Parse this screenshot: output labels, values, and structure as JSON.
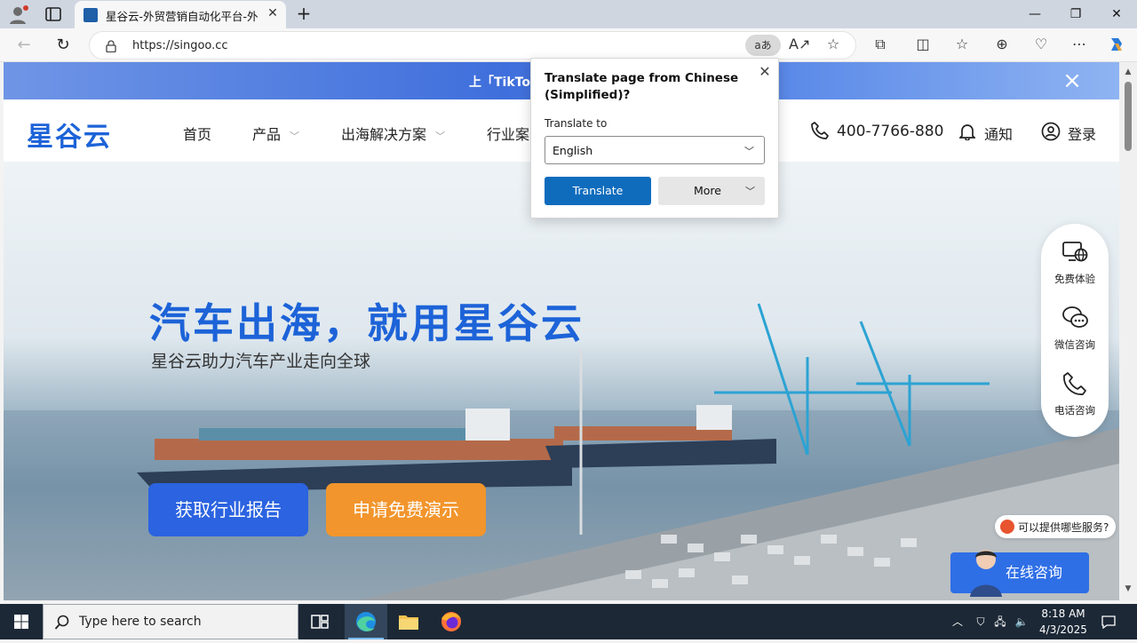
{
  "browser": {
    "tab_title": "星谷云-外贸营销自动化平台-外贸",
    "url": "https://singoo.cc",
    "translate_pill": "aあ"
  },
  "promo": {
    "text": "上「TikTok"
  },
  "site": {
    "logo": "星谷云",
    "nav": [
      {
        "label": "首页"
      },
      {
        "label": "产品"
      },
      {
        "label": "出海解决方案"
      },
      {
        "label": "行业案"
      }
    ],
    "phone": "400-7766-880",
    "notice": "通知",
    "login": "登录"
  },
  "hero": {
    "title": "汽车出海，就用星谷云",
    "subtitle": "星谷云助力汽车产业走向全球",
    "btn_report": "获取行业报告",
    "btn_demo": "申请免费演示"
  },
  "side_panel": {
    "items": [
      {
        "label": "免费体验",
        "icon": "monitor-globe-icon"
      },
      {
        "label": "微信咨询",
        "icon": "chat-bubbles-icon"
      },
      {
        "label": "电话咨询",
        "icon": "phone-icon"
      }
    ]
  },
  "chat": {
    "tip": "可以提供哪些服务?",
    "online": "在线咨询"
  },
  "translate_popup": {
    "title": "Translate page from Chinese (Simplified)?",
    "label": "Translate to",
    "selected": "English",
    "translate_btn": "Translate",
    "more_btn": "More"
  },
  "taskbar": {
    "search_placeholder": "Type here to search",
    "time": "8:18 AM",
    "date": "4/3/2025"
  },
  "colors": {
    "brand_blue": "#1d63d8",
    "demo_orange": "#f2952c",
    "translate_blue": "#0f6cbd"
  }
}
